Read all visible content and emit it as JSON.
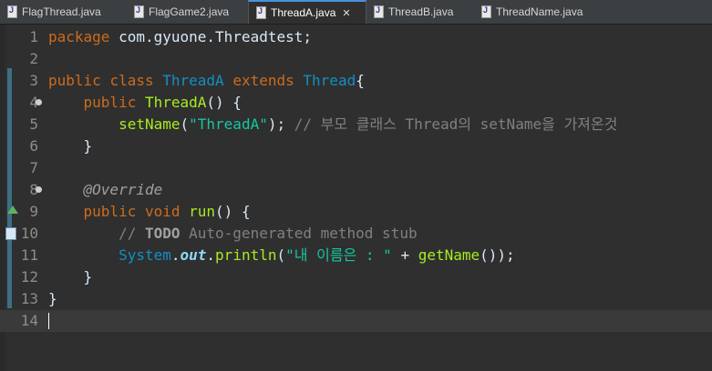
{
  "tabs": [
    {
      "label": "FlagThread.java",
      "active": false
    },
    {
      "label": "FlagGame2.java",
      "active": false
    },
    {
      "label": "ThreadA.java",
      "active": true
    },
    {
      "label": "ThreadB.java",
      "active": false
    },
    {
      "label": "ThreadName.java",
      "active": false
    }
  ],
  "tab_close_glyph": "✕",
  "colors": {
    "keyword": "#cc6c1d",
    "class_name": "#1290c3",
    "method": "#a7ec21",
    "string": "#17c6a3",
    "comment": "#808080",
    "background": "#2f2f2f",
    "current_line": "#3a3a3a"
  },
  "editor": {
    "lines": [
      {
        "n": "1",
        "tokens": [
          [
            "kw",
            "package"
          ],
          [
            "pl",
            " com.gyuone.Threadtest;"
          ]
        ]
      },
      {
        "n": "2",
        "tokens": []
      },
      {
        "n": "3",
        "tokens": [
          [
            "kw",
            "public"
          ],
          [
            "pl",
            " "
          ],
          [
            "kw",
            "class"
          ],
          [
            "pl",
            " "
          ],
          [
            "cls",
            "ThreadA"
          ],
          [
            "pl",
            " "
          ],
          [
            "kw",
            "extends"
          ],
          [
            "pl",
            " "
          ],
          [
            "cls",
            "Thread"
          ],
          [
            "pl",
            "{"
          ]
        ]
      },
      {
        "n": "4",
        "fold": true,
        "tokens": [
          [
            "pl",
            "    "
          ],
          [
            "kw",
            "public"
          ],
          [
            "pl",
            " "
          ],
          [
            "mth",
            "ThreadA"
          ],
          [
            "pl",
            "() {"
          ]
        ]
      },
      {
        "n": "5",
        "tokens": [
          [
            "pl",
            "        "
          ],
          [
            "mth",
            "setName"
          ],
          [
            "pl",
            "("
          ],
          [
            "str",
            "\"ThreadA\""
          ],
          [
            "pl",
            "); "
          ],
          [
            "cmt",
            "// 부모 클래스 Thread의 setName을 가져온것"
          ]
        ]
      },
      {
        "n": "6",
        "tokens": [
          [
            "pl",
            "    }"
          ]
        ]
      },
      {
        "n": "7",
        "tokens": []
      },
      {
        "n": "8",
        "fold": true,
        "tokens": [
          [
            "pl",
            "    "
          ],
          [
            "ann",
            "@Override"
          ]
        ]
      },
      {
        "n": "9",
        "override_marker": true,
        "tokens": [
          [
            "pl",
            "    "
          ],
          [
            "kw",
            "public"
          ],
          [
            "pl",
            " "
          ],
          [
            "kw",
            "void"
          ],
          [
            "pl",
            " "
          ],
          [
            "mth",
            "run"
          ],
          [
            "pl",
            "() {"
          ]
        ]
      },
      {
        "n": "10",
        "todo_marker": true,
        "tokens": [
          [
            "pl",
            "        "
          ],
          [
            "cmt",
            "// "
          ],
          [
            "todo",
            "TODO"
          ],
          [
            "cmt",
            " Auto-generated method stub"
          ]
        ]
      },
      {
        "n": "11",
        "tokens": [
          [
            "pl",
            "        "
          ],
          [
            "cls",
            "System"
          ],
          [
            "pl",
            "."
          ],
          [
            "fld",
            "out"
          ],
          [
            "pl",
            "."
          ],
          [
            "mth",
            "println"
          ],
          [
            "pl",
            "("
          ],
          [
            "str",
            "\"내 이름은 : \""
          ],
          [
            "pl",
            " + "
          ],
          [
            "mth",
            "getName"
          ],
          [
            "pl",
            "());"
          ]
        ]
      },
      {
        "n": "12",
        "tokens": [
          [
            "pl",
            "    }"
          ]
        ]
      },
      {
        "n": "13",
        "tokens": [
          [
            "pl",
            "}"
          ]
        ]
      },
      {
        "n": "14",
        "current": true,
        "caret": true,
        "tokens": []
      }
    ]
  }
}
